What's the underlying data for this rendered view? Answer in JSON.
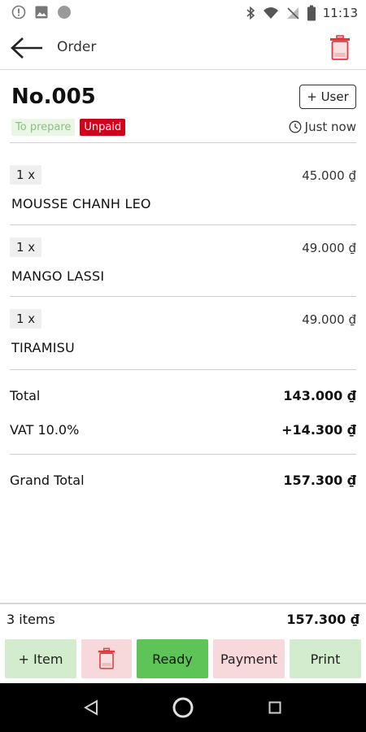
{
  "statusbar": {
    "time": "11:13"
  },
  "appbar": {
    "title": "Order"
  },
  "order": {
    "number": "No.005",
    "user_button": "+ User",
    "status_prepare": "To prepare",
    "status_paid": "Unpaid",
    "time_ago": "Just now"
  },
  "items": [
    {
      "qty": "1 x",
      "name": "MOUSSE CHANH LEO",
      "price": "45.000 ₫"
    },
    {
      "qty": "1 x",
      "name": "MANGO LASSI",
      "price": "49.000 ₫"
    },
    {
      "qty": "1 x",
      "name": "TIRAMISU",
      "price": "49.000 ₫"
    }
  ],
  "summary": {
    "total_label": "Total",
    "total_value": "143.000 ₫",
    "vat_label": "VAT 10.0%",
    "vat_value": "+14.300 ₫",
    "grand_label": "Grand Total",
    "grand_value": "157.300 ₫"
  },
  "footer": {
    "items_count": "3 items",
    "total": "157.300 ₫"
  },
  "actions": {
    "add_item": "+ Item",
    "ready": "Ready",
    "payment": "Payment",
    "print": "Print"
  },
  "colors": {
    "unpaid_badge": "#d0021b",
    "prepare_badge_bg": "#eaf6e6",
    "ready_button": "#5fc457",
    "green_button": "#d3eccd",
    "pink_button": "#f7d9dc",
    "trash_icon": "#e0393e"
  }
}
